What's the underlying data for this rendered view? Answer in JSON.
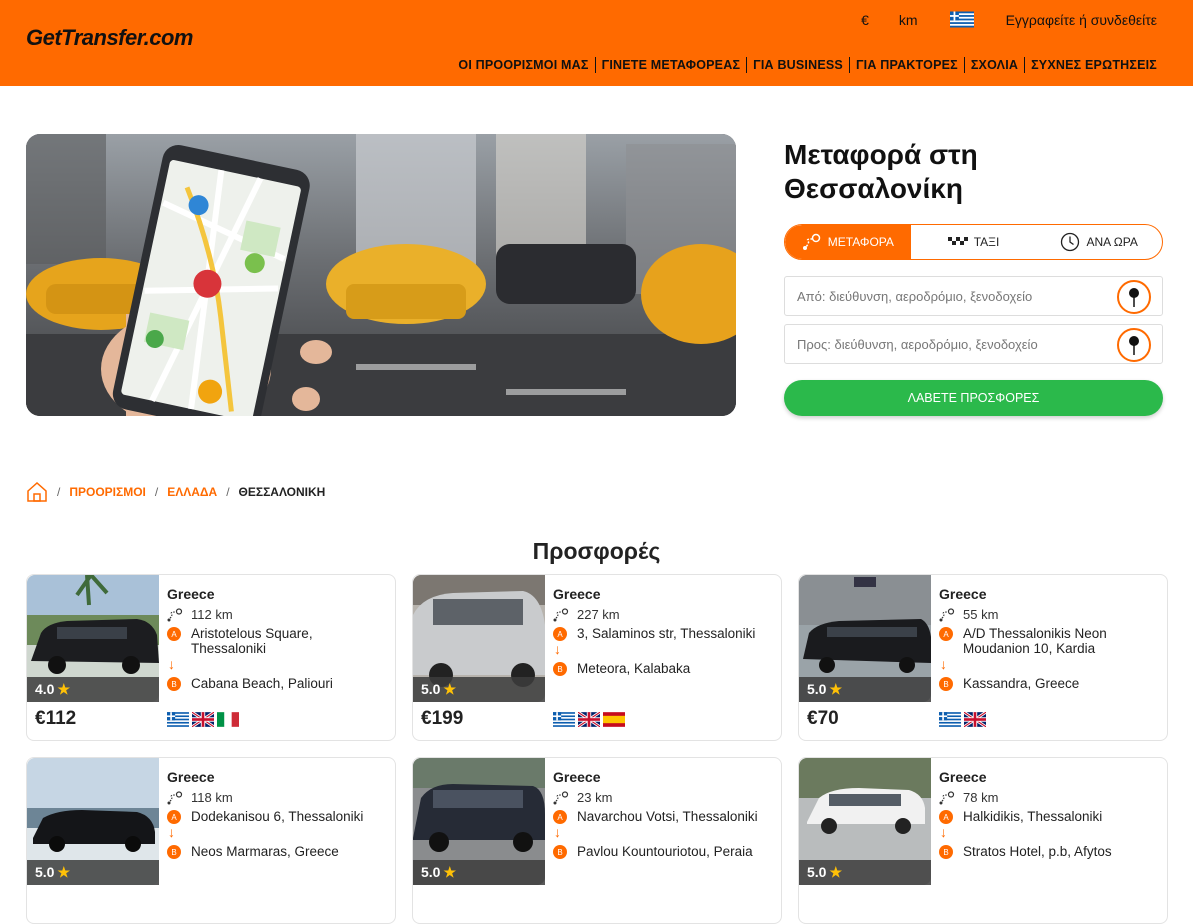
{
  "header": {
    "logo": "GetTransfer.com",
    "currency": "€",
    "unit": "km",
    "login": "Εγγραφείτε ή συνδεθείτε",
    "nav": [
      "ΟΙ ΠΡΟΟΡΙΣΜΟΙ ΜΑΣ",
      "ΓΙΝΕΤΕ ΜΕΤΑΦΟΡΕΑΣ",
      "ΓΙΑ BUSINESS",
      "ΓΙΑ ΠΡΑΚΤΟΡΕΣ",
      "ΣΧΟΛΙΑ",
      "ΣΥΧΝΕΣ ΕΡΩΤΗΣΕΙΣ"
    ]
  },
  "booking": {
    "title": "Μεταφορά στη Θεσσαλονίκη",
    "tabs": [
      "ΜΕΤΑΦΟΡΑ",
      "ΤΑΞΙ",
      "ΑΝΑ ΩΡΑ"
    ],
    "from_placeholder": "Από: διεύθυνση, αεροδρόμιο, ξενοδοχείο",
    "to_placeholder": "Προς: διεύθυνση, αεροδρόμιο, ξενοδοχείο",
    "cta": "ΛΑΒΕΤΕ ΠΡΟΣΦΟΡΕΣ"
  },
  "breadcrumb": {
    "sep": "/",
    "items": [
      "ΠΡΟΟΡΙΣΜΟΙ",
      "ΕΛΛΑΔΑ",
      "ΘΕΣΣΑΛΟΝΙΚΗ"
    ]
  },
  "offers": {
    "title": "Προσφορές",
    "badge_a": "A",
    "badge_b": "B",
    "arrow": "↓",
    "star": "★",
    "cards": [
      {
        "country": "Greece",
        "distance": "112 km",
        "from": "Aristotelous Square, Thessaloniki",
        "to": "Cabana Beach, Paliouri",
        "rating": "4.0",
        "price": "€112",
        "langs": [
          "gr",
          "uk",
          "it"
        ],
        "car": "black-van"
      },
      {
        "country": "Greece",
        "distance": "227 km",
        "from": "3, Salaminos str, Thessaloniki",
        "to": "Meteora, Kalabaka",
        "rating": "5.0",
        "price": "€199",
        "langs": [
          "gr",
          "uk",
          "es"
        ],
        "car": "silver-hatch"
      },
      {
        "country": "Greece",
        "distance": "55 km",
        "from": "A/D Thessalonikis Neon Moudanion 10, Kardia",
        "to": "Kassandra, Greece",
        "rating": "5.0",
        "price": "€70",
        "langs": [
          "gr",
          "uk"
        ],
        "car": "black-van-2"
      },
      {
        "country": "Greece",
        "distance": "118 km",
        "from": "Dodekanisou 6, Thessaloniki",
        "to": "Neos Marmaras, Greece",
        "rating": "5.0",
        "price": "",
        "langs": [],
        "car": "black-sedan"
      },
      {
        "country": "Greece",
        "distance": "23 km",
        "from": "Navarchou Votsi, Thessaloniki",
        "to": "Pavlou Kountouriotou, Peraia",
        "rating": "5.0",
        "price": "",
        "langs": [],
        "car": "dark-wagon"
      },
      {
        "country": "Greece",
        "distance": "78 km",
        "from": "Halkidikis, Thessaloniki",
        "to": "Stratos Hotel, p.b, Afytos",
        "rating": "5.0",
        "price": "",
        "langs": [],
        "car": "white-wagon"
      }
    ]
  },
  "colors": {
    "brand": "#ff6a00",
    "cta": "#2bb94b"
  }
}
